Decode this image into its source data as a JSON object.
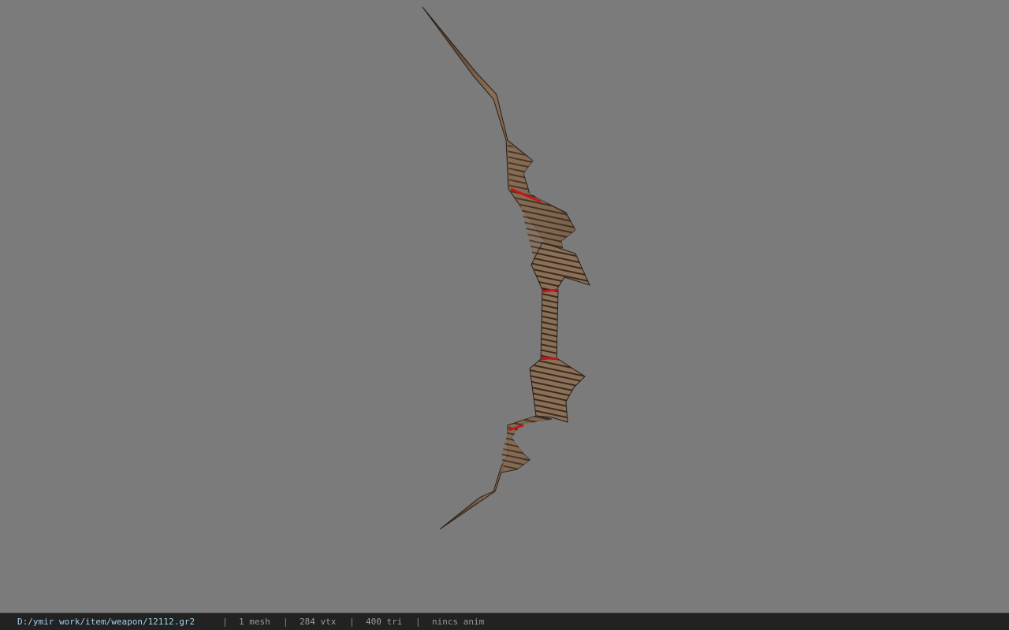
{
  "viewer": {
    "background_color": "#7b7b7b",
    "model": "bow"
  },
  "status_bar": {
    "file_path": "D:/ymir work/item/weapon/12112.gr2",
    "mesh_count": "1 mesh",
    "vertex_count": "284 vtx",
    "triangle_count": "400 tri",
    "animation": "nincs anim",
    "separator": "|",
    "path_color": "#9fd0ea",
    "text_color": "#9a9a9a"
  }
}
